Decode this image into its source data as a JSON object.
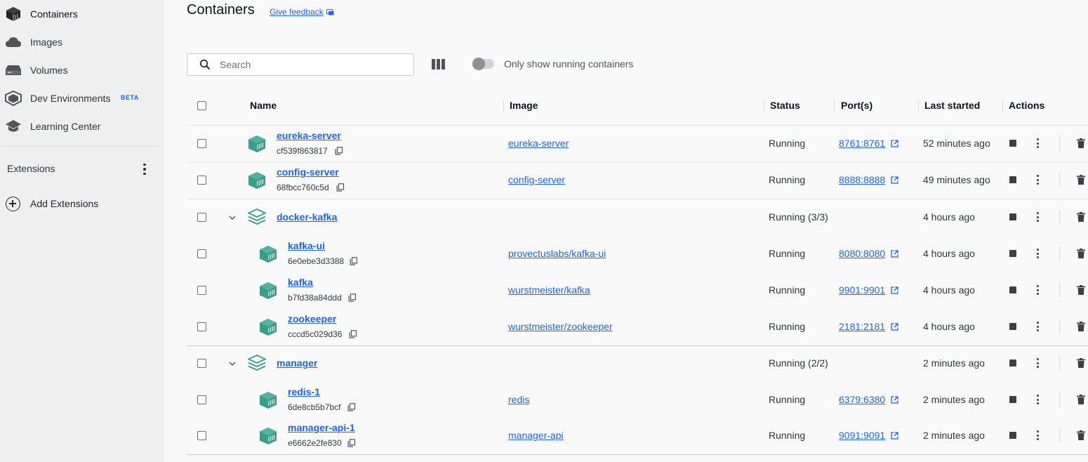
{
  "sidebar": {
    "items": [
      {
        "label": "Containers",
        "icon": "containers-icon",
        "active": true
      },
      {
        "label": "Images",
        "icon": "cloud-icon"
      },
      {
        "label": "Volumes",
        "icon": "volume-icon"
      },
      {
        "label": "Dev Environments",
        "icon": "dev-env-icon",
        "badge": "BETA"
      },
      {
        "label": "Learning Center",
        "icon": "graduation-cap-icon"
      }
    ],
    "extensions_title": "Extensions",
    "add_extensions": "Add Extensions"
  },
  "header": {
    "title": "Containers",
    "feedback": "Give feedback"
  },
  "toolbar": {
    "search_placeholder": "Search",
    "toggle_label": "Only show running containers"
  },
  "table": {
    "columns": {
      "name": "Name",
      "image": "Image",
      "status": "Status",
      "ports": "Port(s)",
      "last_started": "Last started",
      "actions": "Actions"
    },
    "rows": [
      {
        "name": "eureka-server",
        "id": "cf539f863817",
        "image": "eureka-server",
        "status": "Running",
        "port": "8761:8761",
        "last": "52 minutes ago"
      },
      {
        "name": "config-server",
        "id": "68fbcc760c5d",
        "image": "config-server",
        "status": "Running",
        "port": "8888:8888",
        "last": "49 minutes ago"
      },
      {
        "name": "docker-kafka",
        "status": "Running (3/3)",
        "last": "4 hours ago",
        "group": true
      },
      {
        "name": "kafka-ui",
        "id": "6e0ebe3d3388",
        "image": "provectuslabs/kafka-ui",
        "status": "Running",
        "port": "8080:8080",
        "last": "4 hours ago"
      },
      {
        "name": "kafka",
        "id": "b7fd38a84ddd",
        "image": "wurstmeister/kafka",
        "status": "Running",
        "port": "9901:9901",
        "last": "4 hours ago"
      },
      {
        "name": "zookeeper",
        "id": "cccd5c029d36",
        "image": "wurstmeister/zookeeper",
        "status": "Running",
        "port": "2181:2181",
        "last": "4 hours ago"
      },
      {
        "name": "manager",
        "status": "Running (2/2)",
        "last": "2 minutes ago",
        "group": true
      },
      {
        "name": "redis-1",
        "id": "6de8cb5b7bcf",
        "image": "redis",
        "status": "Running",
        "port": "6379:6380",
        "last": "2 minutes ago"
      },
      {
        "name": "manager-api-1",
        "id": "e6662e2fe830",
        "image": "manager-api",
        "status": "Running",
        "port": "9091:9091",
        "last": "2 minutes ago"
      }
    ]
  },
  "colors": {
    "accent": "#1d63ed",
    "container_icon": "#3a9c8a",
    "sidebar_bg": "#efeff0"
  }
}
